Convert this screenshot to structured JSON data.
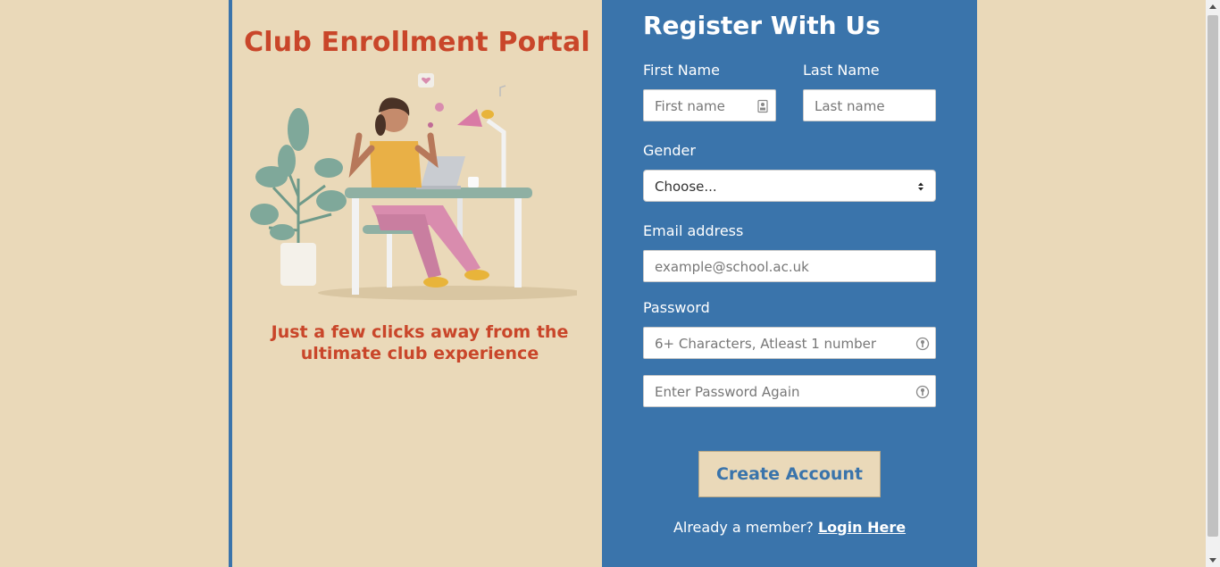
{
  "left": {
    "title": "Club Enrollment Portal",
    "tagline_line1": "Just a few clicks away from the",
    "tagline_line2": "ultimate club experience"
  },
  "form": {
    "title": "Register With Us",
    "first_name": {
      "label": "First Name",
      "placeholder": "First name",
      "icon": "contact-card-icon"
    },
    "last_name": {
      "label": "Last Name",
      "placeholder": "Last name"
    },
    "gender": {
      "label": "Gender",
      "selected": "Choose..."
    },
    "email": {
      "label": "Email address",
      "placeholder": "example@school.ac.uk"
    },
    "password": {
      "label": "Password",
      "placeholder": "6+ Characters, Atleast 1 number",
      "icon": "key-icon"
    },
    "password_confirm": {
      "placeholder": "Enter Password Again",
      "icon": "key-icon"
    },
    "submit_label": "Create Account",
    "login_prompt": "Already a member?",
    "login_link": "Login Here"
  },
  "colors": {
    "page_bg": "#ead9b9",
    "accent_blue": "#3a74ab",
    "title_red": "#c9462a"
  }
}
